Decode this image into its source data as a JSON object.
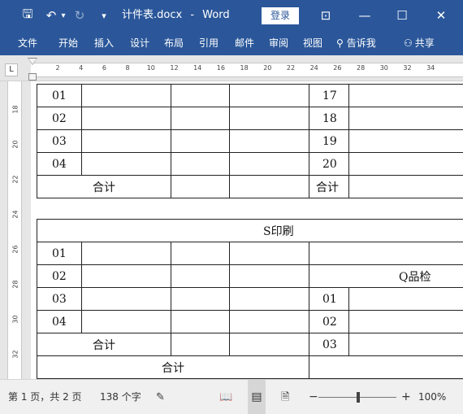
{
  "titlebar": {
    "save_glyph": "🖫",
    "undo_glyph": "↶",
    "undo_arrow": "▾",
    "redo_glyph": "↻",
    "customize_glyph": "▾",
    "doc_title": "计件表.docx",
    "separator": "-",
    "app": "Word",
    "login": "登录",
    "ribbon_options_glyph": "⊡",
    "minimize_glyph": "—",
    "maximize_glyph": "☐",
    "close_glyph": "✕"
  },
  "tabs": [
    "文件",
    "开始",
    "插入",
    "设计",
    "布局",
    "引用",
    "邮件",
    "审阅",
    "视图"
  ],
  "tell_me": "告诉我",
  "tell_me_glyph": "⚲",
  "share": "共享",
  "share_glyph": "⚇",
  "ruler": {
    "corner": "L",
    "ticks": [
      "2",
      "4",
      "6",
      "8",
      "10",
      "12",
      "14",
      "16",
      "18",
      "20",
      "22",
      "24",
      "26",
      "28",
      "30",
      "32",
      "34"
    ],
    "vticks": [
      "18",
      "20",
      "22",
      "24",
      "26",
      "28",
      "30",
      "32"
    ]
  },
  "table1": {
    "rows": [
      {
        "no": "01",
        "right": "17"
      },
      {
        "no": "02",
        "right": "18"
      },
      {
        "no": "03",
        "right": "19"
      },
      {
        "no": "04",
        "right": "20"
      }
    ],
    "total_left": "合计",
    "total_right": "合计"
  },
  "table2": {
    "header": "S印刷",
    "rows": [
      {
        "no": "01",
        "right": ""
      },
      {
        "no": "02",
        "right": "Q品检"
      },
      {
        "no": "03",
        "right": "01"
      },
      {
        "no": "04",
        "right": "02"
      }
    ],
    "subtotal": "合计",
    "subtotal_right": "03",
    "total": "合计"
  },
  "status": {
    "page": "第 1 页，共 2 页",
    "words": "138 个字",
    "proof_glyph": "✎",
    "read_glyph": "📖",
    "print_glyph": "▤",
    "web_glyph": "🗎",
    "minus": "−",
    "plus": "+",
    "zoom": "100%"
  }
}
